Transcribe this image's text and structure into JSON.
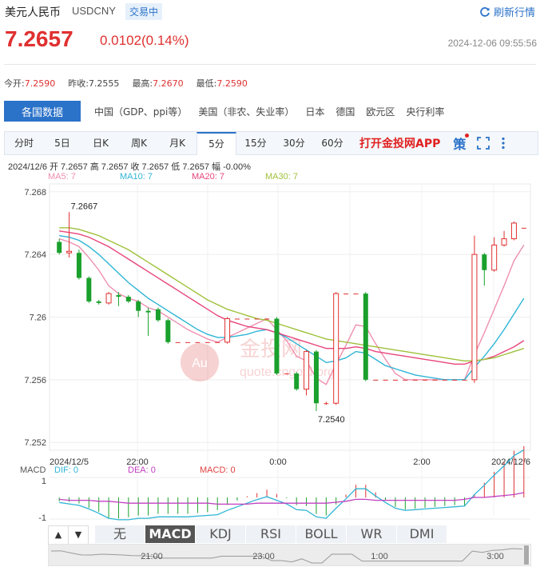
{
  "header": {
    "name": "美元人民币",
    "code": "USDCNY",
    "status": "交易中",
    "refresh_label": "刷新行情",
    "price": "7.2657",
    "change": "0.0102(0.14%)",
    "timestamp": "2024-12-06 09:55:56"
  },
  "stats": [
    {
      "label": "今开:",
      "value": "7.2590"
    },
    {
      "label": "昨收:",
      "value": "7.2555"
    },
    {
      "label": "最高:",
      "value": "7.2670"
    },
    {
      "label": "最低:",
      "value": "7.2590"
    }
  ],
  "nav": {
    "active": "各国数据",
    "items": [
      "中国（GDP、ppi等）",
      "美国（非农、失业率）",
      "日本",
      "德国",
      "欧元区",
      "央行利率"
    ]
  },
  "tabs": {
    "items": [
      "分时",
      "5日",
      "日K",
      "周K",
      "月K",
      "5分",
      "15分",
      "30分",
      "60分"
    ],
    "selected": "5分",
    "app_link": "打开金投网APP",
    "icons": [
      "strategy-icon",
      "fullscreen-icon",
      "more-icon"
    ],
    "strategy_glyph": "策"
  },
  "ohlc_line": "2024/12/6  开 7.2657  高 7.2657  收 7.2657  低 7.2657  幅 -0.00%",
  "ma_labels": [
    {
      "text": "MA5: 7",
      "color": "#ef8fb0"
    },
    {
      "text": "MA10: 7",
      "color": "#2fb5d5"
    },
    {
      "text": "MA20: 7",
      "color": "#e8457a"
    },
    {
      "text": "MA30: 7",
      "color": "#9ec13a"
    }
  ],
  "macd_labels": {
    "name": "MACD",
    "dif": "DIF: 0",
    "dea": "DEA: 0",
    "macd": "MACD: 0"
  },
  "watermark": "金投网",
  "watermark_url": "quote.cngold.org",
  "watermark_logo": "Au",
  "bottom_tabs": {
    "items": [
      "无",
      "MACD",
      "KDJ",
      "RSI",
      "BOLL",
      "WR",
      "DMI"
    ],
    "selected": "MACD",
    "up_arrow": "▲",
    "down_arrow": "▼"
  },
  "chart_data": {
    "type": "candlestick",
    "y_ticks": [
      "7.268",
      "7.264",
      "7.26",
      "7.256",
      "7.252"
    ],
    "ylim": [
      7.2515,
      7.2685
    ],
    "x_ticks": [
      "2024/12/5",
      "22:00",
      "0:00",
      "2:00",
      "2024/12/6"
    ],
    "macd_y_ticks": [
      "1",
      "-1"
    ],
    "navigator_ticks": [
      "21:00",
      "23:00",
      "1:00",
      "3:00"
    ],
    "annotations": [
      {
        "text": "7.2667",
        "value": 7.2667
      },
      {
        "text": "7.2540",
        "value": 7.254
      }
    ],
    "candles": [
      {
        "o": 7.2648,
        "c": 7.2641,
        "h": 7.265,
        "l": 7.264
      },
      {
        "o": 7.2641,
        "c": 7.2642,
        "h": 7.2667,
        "l": 7.2638
      },
      {
        "o": 7.2641,
        "c": 7.2625,
        "h": 7.2643,
        "l": 7.2624
      },
      {
        "o": 7.2625,
        "c": 7.261,
        "h": 7.2626,
        "l": 7.2609
      },
      {
        "o": 7.261,
        "c": 7.2609,
        "h": 7.2611,
        "l": 7.2608
      },
      {
        "o": 7.2609,
        "c": 7.2615,
        "h": 7.2616,
        "l": 7.2608
      },
      {
        "o": 7.2614,
        "c": 7.2613,
        "h": 7.2616,
        "l": 7.2607
      },
      {
        "o": 7.2613,
        "c": 7.261,
        "h": 7.2614,
        "l": 7.2609
      },
      {
        "o": 7.261,
        "c": 7.2604,
        "h": 7.2611,
        "l": 7.26
      },
      {
        "o": 7.2604,
        "c": 7.2603,
        "h": 7.2606,
        "l": 7.2588
      },
      {
        "o": 7.2605,
        "c": 7.2598,
        "h": 7.2606,
        "l": 7.2597
      },
      {
        "o": 7.2598,
        "c": 7.2584,
        "h": 7.2599,
        "l": 7.2583
      },
      {
        "o": 7.2584,
        "c": 7.2584,
        "h": 7.2584,
        "l": 7.2584
      },
      {
        "o": 7.2584,
        "c": 7.2584,
        "h": 7.2584,
        "l": 7.2584
      },
      {
        "o": 7.2584,
        "c": 7.2584,
        "h": 7.2584,
        "l": 7.2584
      },
      {
        "o": 7.2584,
        "c": 7.2584,
        "h": 7.2584,
        "l": 7.2584
      },
      {
        "o": 7.2584,
        "c": 7.2584,
        "h": 7.2584,
        "l": 7.2584
      },
      {
        "o": 7.2584,
        "c": 7.2599,
        "h": 7.26,
        "l": 7.2583
      },
      {
        "o": 7.2599,
        "c": 7.2599,
        "h": 7.2599,
        "l": 7.2599
      },
      {
        "o": 7.2599,
        "c": 7.2599,
        "h": 7.2599,
        "l": 7.2599
      },
      {
        "o": 7.2599,
        "c": 7.2599,
        "h": 7.2599,
        "l": 7.2599
      },
      {
        "o": 7.2599,
        "c": 7.2599,
        "h": 7.2599,
        "l": 7.2599
      },
      {
        "o": 7.2599,
        "c": 7.2564,
        "h": 7.26,
        "l": 7.2563
      },
      {
        "o": 7.2564,
        "c": 7.2564,
        "h": 7.2564,
        "l": 7.2564
      },
      {
        "o": 7.2564,
        "c": 7.2554,
        "h": 7.2565,
        "l": 7.2553
      },
      {
        "o": 7.2554,
        "c": 7.2578,
        "h": 7.2579,
        "l": 7.255
      },
      {
        "o": 7.2578,
        "c": 7.2545,
        "h": 7.2579,
        "l": 7.254
      },
      {
        "o": 7.2545,
        "c": 7.2545,
        "h": 7.2546,
        "l": 7.2544
      },
      {
        "o": 7.2545,
        "c": 7.2615,
        "h": 7.2616,
        "l": 7.2544
      },
      {
        "o": 7.2615,
        "c": 7.2615,
        "h": 7.2615,
        "l": 7.2615
      },
      {
        "o": 7.2615,
        "c": 7.2615,
        "h": 7.2615,
        "l": 7.2615
      },
      {
        "o": 7.2615,
        "c": 7.256,
        "h": 7.2616,
        "l": 7.2559
      },
      {
        "o": 7.256,
        "c": 7.256,
        "h": 7.256,
        "l": 7.256
      },
      {
        "o": 7.256,
        "c": 7.256,
        "h": 7.256,
        "l": 7.256
      },
      {
        "o": 7.256,
        "c": 7.256,
        "h": 7.256,
        "l": 7.256
      },
      {
        "o": 7.256,
        "c": 7.256,
        "h": 7.256,
        "l": 7.256
      },
      {
        "o": 7.256,
        "c": 7.256,
        "h": 7.256,
        "l": 7.256
      },
      {
        "o": 7.256,
        "c": 7.256,
        "h": 7.256,
        "l": 7.256
      },
      {
        "o": 7.256,
        "c": 7.256,
        "h": 7.256,
        "l": 7.256
      },
      {
        "o": 7.256,
        "c": 7.256,
        "h": 7.256,
        "l": 7.256
      },
      {
        "o": 7.256,
        "c": 7.256,
        "h": 7.256,
        "l": 7.256
      },
      {
        "o": 7.256,
        "c": 7.256,
        "h": 7.256,
        "l": 7.256
      },
      {
        "o": 7.256,
        "c": 7.264,
        "h": 7.2652,
        "l": 7.2558
      },
      {
        "o": 7.264,
        "c": 7.263,
        "h": 7.2641,
        "l": 7.262
      },
      {
        "o": 7.263,
        "c": 7.2646,
        "h": 7.2651,
        "l": 7.2629
      },
      {
        "o": 7.2646,
        "c": 7.265,
        "h": 7.2655,
        "l": 7.2645
      },
      {
        "o": 7.265,
        "c": 7.266,
        "h": 7.2661,
        "l": 7.2649
      },
      {
        "o": 7.2657,
        "c": 7.2657,
        "h": 7.2657,
        "l": 7.2657
      }
    ],
    "series": [
      {
        "name": "MA5",
        "color": "#ef8fb0",
        "values": [
          7.265,
          7.2648,
          7.2645,
          7.2638,
          7.263,
          7.262,
          7.2615,
          7.2612,
          7.261,
          7.2606,
          7.2604,
          7.26,
          7.2596,
          7.2592,
          7.2589,
          7.2586,
          7.2584,
          7.2587,
          7.259,
          7.2593,
          7.2596,
          7.2599,
          7.2592,
          7.2585,
          7.2575,
          7.2572,
          7.2561,
          7.2557,
          7.257,
          7.2582,
          7.2595,
          7.2594,
          7.2583,
          7.2573,
          7.2564,
          7.256,
          7.256,
          7.256,
          7.256,
          7.256,
          7.256,
          7.256,
          7.2576,
          7.259,
          7.2605,
          7.262,
          7.2636,
          7.2646
        ]
      },
      {
        "name": "MA10",
        "color": "#2fb5d5",
        "values": [
          7.2652,
          7.2651,
          7.2649,
          7.2645,
          7.264,
          7.2634,
          7.2628,
          7.2622,
          7.2617,
          7.2612,
          7.2608,
          7.2604,
          7.26,
          7.2596,
          7.2592,
          7.2589,
          7.2587,
          7.2587,
          7.2588,
          7.2589,
          7.2591,
          7.2592,
          7.259,
          7.2587,
          7.2583,
          7.2579,
          7.2575,
          7.2571,
          7.2572,
          7.2574,
          7.2578,
          7.2577,
          7.2573,
          7.2569,
          7.2567,
          7.2565,
          7.2563,
          7.2562,
          7.2561,
          7.256,
          7.256,
          7.256,
          7.2568,
          7.2575,
          7.2583,
          7.2592,
          7.2602,
          7.2612
        ]
      },
      {
        "name": "MA20",
        "color": "#e8457a",
        "values": [
          7.2655,
          7.2654,
          7.2653,
          7.2651,
          7.2648,
          7.2645,
          7.2641,
          7.2637,
          7.2633,
          7.2629,
          7.2625,
          7.2621,
          7.2617,
          7.2613,
          7.2609,
          7.2605,
          7.2601,
          7.2598,
          7.2596,
          7.2594,
          7.2593,
          7.2592,
          7.259,
          7.2588,
          7.2586,
          7.2584,
          7.2582,
          7.258,
          7.258,
          7.258,
          7.2581,
          7.258,
          7.2578,
          7.2577,
          7.2576,
          7.2575,
          7.2574,
          7.2573,
          7.2572,
          7.2571,
          7.257,
          7.257,
          7.2572,
          7.2573,
          7.2575,
          7.2578,
          7.2581,
          7.2585
        ]
      },
      {
        "name": "MA30",
        "color": "#9ec13a",
        "values": [
          7.2657,
          7.2657,
          7.2656,
          7.2654,
          7.2652,
          7.2649,
          7.2646,
          7.2643,
          7.2639,
          7.2635,
          7.2631,
          7.2627,
          7.2623,
          7.2619,
          7.2615,
          7.2611,
          7.2608,
          7.2605,
          7.2603,
          7.2601,
          7.2599,
          7.2598,
          7.2596,
          7.2594,
          7.2592,
          7.259,
          7.2588,
          7.2586,
          7.2585,
          7.2584,
          7.2583,
          7.2582,
          7.2581,
          7.258,
          7.2579,
          7.2578,
          7.2577,
          7.2576,
          7.2575,
          7.2574,
          7.2573,
          7.2572,
          7.2572,
          7.2573,
          7.2574,
          7.2576,
          7.2578,
          7.258
        ]
      }
    ]
  }
}
